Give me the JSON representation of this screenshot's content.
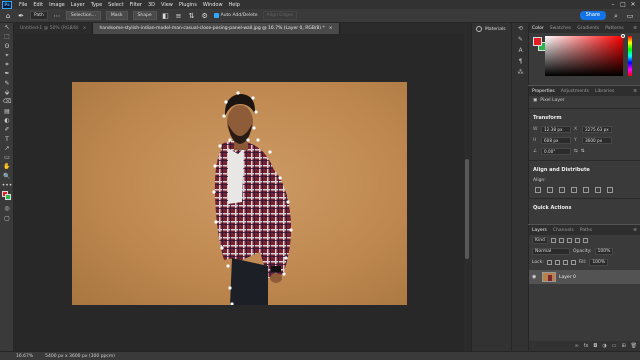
{
  "app": {
    "logo": "Ps"
  },
  "menu": [
    "File",
    "Edit",
    "Image",
    "Layer",
    "Type",
    "Select",
    "Filter",
    "3D",
    "View",
    "Plugins",
    "Window",
    "Help"
  ],
  "window_controls": {
    "minimize": "–",
    "maximize": "□",
    "close": "✕"
  },
  "options_bar": {
    "path_mode": "Path",
    "selection_label": "Selection...",
    "mask_label": "Mask",
    "shape_label": "Shape",
    "auto_add_delete": "Auto Add/Delete",
    "align_edges": "Align Edges",
    "share_label": "Share"
  },
  "tabs": [
    {
      "title": "Untitled-1 @ 50% (RGB/8)",
      "close": "×"
    },
    {
      "title": "handsome-stylish-indian-model-man-casual-close-posing-panel-wall.jpg @ 16.7% (Layer 0, RGB/8) *",
      "close": "×"
    }
  ],
  "toolbar_icons": [
    "↖",
    "⬚",
    "ʘ",
    "⌖",
    "⌗",
    "✒",
    "✎",
    "⬙",
    "⌫",
    "▤",
    "◐",
    "✐",
    "T",
    "↗",
    "▭",
    "✋",
    "🔍",
    "•••"
  ],
  "mini_panel": {
    "materials_label": "Materials"
  },
  "color_panel": {
    "tabs": [
      "Color",
      "Swatches",
      "Gradients",
      "Patterns"
    ],
    "foreground": "#e51c23",
    "background": "#29b34a"
  },
  "properties_panel": {
    "tabs": [
      "Properties",
      "Adjustments",
      "Libraries"
    ],
    "pixel_layer": "Pixel Layer",
    "transform_title": "Transform",
    "w": "12.38 px",
    "x": "2275.63 px",
    "h": "608 px",
    "y": "3600 px",
    "angle": "0.00°",
    "w_label": "W",
    "h_label": "H",
    "x_label": "X",
    "y_label": "Y",
    "align_title": "Align and Distribute",
    "align_label": "Align:",
    "quick_actions": "Quick Actions"
  },
  "layers_panel": {
    "tabs": [
      "Layers",
      "Channels",
      "Paths"
    ],
    "kind_label": "Kind",
    "blend_mode": "Normal",
    "opacity_label": "Opacity:",
    "opacity_value": "100%",
    "lock_label": "Lock:",
    "fill_label": "Fill:",
    "fill_value": "100%",
    "layer_name": "Layer 0"
  },
  "status": {
    "zoom": "16.67%",
    "doc_size": "5400 px x 3600 px (300 ppcm)"
  },
  "accent": "#1473e6"
}
